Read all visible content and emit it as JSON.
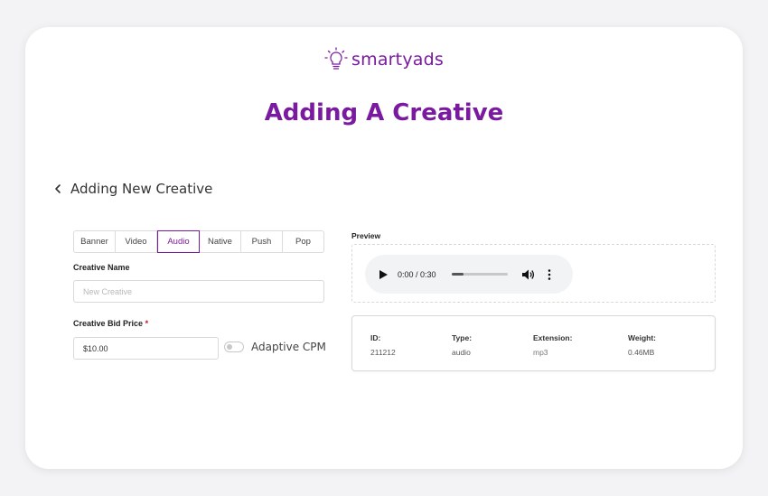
{
  "brand": {
    "name": "smartyads",
    "color": "#7a1aa0"
  },
  "page": {
    "title": "Adding A Creative"
  },
  "nav": {
    "back_label": "Adding New Creative",
    "back_icon": "chevron-left-icon"
  },
  "tabs": [
    {
      "label": "Banner",
      "active": false
    },
    {
      "label": "Video",
      "active": false
    },
    {
      "label": "Audio",
      "active": true
    },
    {
      "label": "Native",
      "active": false
    },
    {
      "label": "Push",
      "active": false
    },
    {
      "label": "Pop",
      "active": false
    }
  ],
  "form": {
    "name_label": "Creative Name",
    "name_placeholder": "New Creative",
    "name_value": "",
    "bid_label": "Creative Bid Price",
    "bid_required_mark": "*",
    "bid_value": "$10.00",
    "adaptive_label": "Adaptive CPM",
    "adaptive_on": false
  },
  "preview": {
    "label": "Preview",
    "player": {
      "time": "0:00 / 0:30",
      "progress": 0.22
    }
  },
  "info": {
    "id_key": "ID:",
    "id_val": "211212",
    "type_key": "Type:",
    "type_val": "audio",
    "ext_key": "Extension:",
    "ext_val": "mp3",
    "weight_key": "Weight:",
    "weight_val": "0.46MB"
  }
}
